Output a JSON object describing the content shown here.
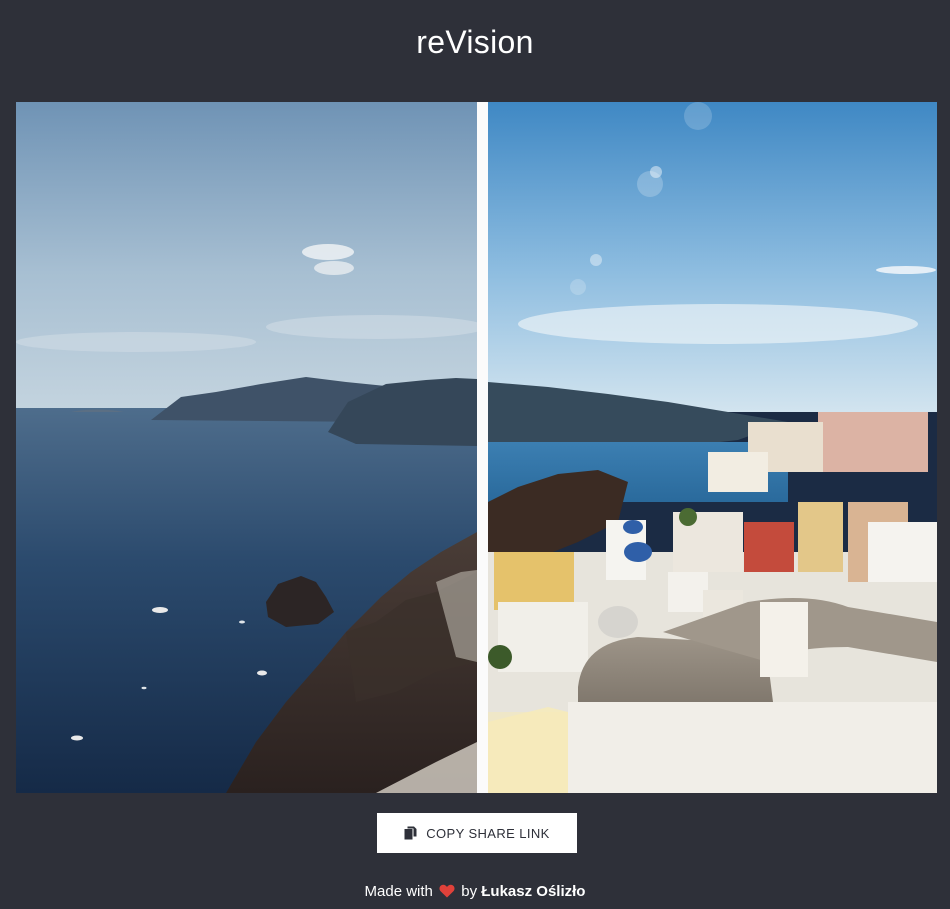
{
  "app": {
    "title": "reVision"
  },
  "comparison": {
    "before_image": "santorini-caldera-original",
    "after_image": "santorini-caldera-edited",
    "divider_position": 0.506
  },
  "share": {
    "button_label": "COPY SHARE LINK",
    "icon": "copy-icon"
  },
  "footer": {
    "prefix": "Made with",
    "heart_icon": "heart-icon",
    "heart_color": "#e0413a",
    "by": "by",
    "author": "Łukasz Oślizło"
  },
  "colors": {
    "background": "#2e3039",
    "divider": "#fbfbfb"
  }
}
